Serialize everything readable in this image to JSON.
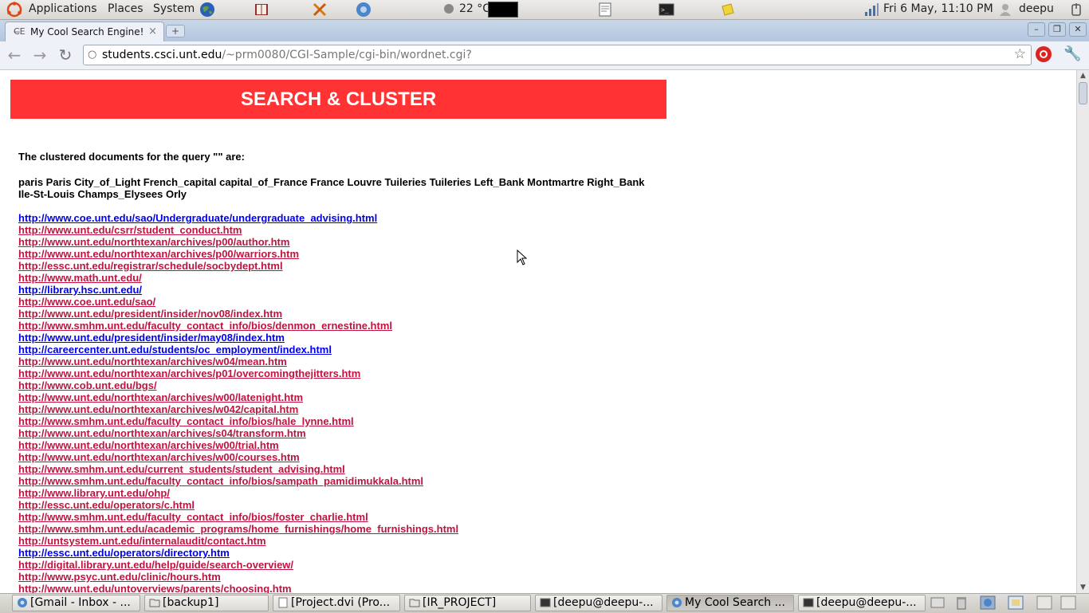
{
  "top_panel": {
    "applications_label": "Applications",
    "places_label": "Places",
    "system_label": "System",
    "temperature": "22 °C",
    "datetime": "Fri  6 May, 11:10 PM",
    "user": "deepu"
  },
  "browser": {
    "tab_title": "My Cool Search Engine!",
    "tab_close": "×",
    "new_tab": "+",
    "url_host": "students.csci.unt.edu",
    "url_path": "/~prm0080/CGI-Sample/cgi-bin/wordnet.cgi?"
  },
  "page": {
    "banner_title": "SEARCH & CLUSTER",
    "heading": "The clustered documents for the query \"\" are:",
    "synonyms": "paris Paris City_of_Light French_capital capital_of_France France Louvre Tuileries Tuileries Left_Bank Montmartre Right_Bank Ile-St-Louis Champs_Elysees Orly",
    "links": [
      {
        "text": "http://www.coe.unt.edu/sao/Undergraduate/undergraduate_advising.html",
        "visited": false
      },
      {
        "text": "http://www.unt.edu/csrr/student_conduct.htm",
        "visited": true
      },
      {
        "text": "http://www.unt.edu/northtexan/archives/p00/author.htm",
        "visited": true
      },
      {
        "text": "http://www.unt.edu/northtexan/archives/p00/warriors.htm",
        "visited": true
      },
      {
        "text": "http://essc.unt.edu/registrar/schedule/socbydept.html",
        "visited": true
      },
      {
        "text": "http://www.math.unt.edu/",
        "visited": true
      },
      {
        "text": "http://library.hsc.unt.edu/",
        "visited": false
      },
      {
        "text": "http://www.coe.unt.edu/sao/",
        "visited": true
      },
      {
        "text": "http://www.unt.edu/president/insider/nov08/index.htm",
        "visited": true
      },
      {
        "text": "http://www.smhm.unt.edu/faculty_contact_info/bios/denmon_ernestine.html",
        "visited": true
      },
      {
        "text": "http://www.unt.edu/president/insider/may08/index.htm",
        "visited": false
      },
      {
        "text": "http://careercenter.unt.edu/students/oc_employment/index.html",
        "visited": false
      },
      {
        "text": "http://www.unt.edu/northtexan/archives/w04/mean.htm",
        "visited": true
      },
      {
        "text": "http://www.unt.edu/northtexan/archives/p01/overcomingthejitters.htm",
        "visited": true
      },
      {
        "text": "http://www.cob.unt.edu/bgs/",
        "visited": true
      },
      {
        "text": "http://www.unt.edu/northtexan/archives/w00/latenight.htm",
        "visited": true
      },
      {
        "text": "http://www.unt.edu/northtexan/archives/w042/capital.htm",
        "visited": true
      },
      {
        "text": "http://www.smhm.unt.edu/faculty_contact_info/bios/hale_lynne.html",
        "visited": true
      },
      {
        "text": "http://www.unt.edu/northtexan/archives/s04/transform.htm",
        "visited": true
      },
      {
        "text": "http://www.unt.edu/northtexan/archives/w00/trial.htm",
        "visited": true
      },
      {
        "text": "http://www.unt.edu/northtexan/archives/w00/courses.htm",
        "visited": true
      },
      {
        "text": "http://www.smhm.unt.edu/current_students/student_advising.html",
        "visited": true
      },
      {
        "text": "http://www.smhm.unt.edu/faculty_contact_info/bios/sampath_pamidimukkala.html",
        "visited": true
      },
      {
        "text": "http://www.library.unt.edu/ohp/",
        "visited": true
      },
      {
        "text": "http://essc.unt.edu/operators/c.html",
        "visited": true
      },
      {
        "text": "http://www.smhm.unt.edu/faculty_contact_info/bios/foster_charlie.html",
        "visited": true
      },
      {
        "text": "http://www.smhm.unt.edu/academic_programs/home_furnishings/home_furnishings.html",
        "visited": true
      },
      {
        "text": "http://untsystem.unt.edu/internalaudit/contact.htm",
        "visited": true
      },
      {
        "text": "http://essc.unt.edu/operators/directory.htm",
        "visited": false
      },
      {
        "text": "http://digital.library.unt.edu/help/guide/search-overview/",
        "visited": true
      },
      {
        "text": "http://www.psyc.unt.edu/clinic/hours.htm",
        "visited": true
      },
      {
        "text": "http://www.unt.edu/untoverviews/parents/choosing.htm",
        "visited": true
      }
    ]
  },
  "taskbar": {
    "tasks": [
      {
        "label": "[Gmail - Inbox - ...",
        "icon": "chrome-icon",
        "active": false
      },
      {
        "label": "[backup1]",
        "icon": "folder-icon",
        "active": false
      },
      {
        "label": "[Project.dvi (Pro...",
        "icon": "document-icon",
        "active": false
      },
      {
        "label": "[IR_PROJECT]",
        "icon": "folder-icon",
        "active": false
      },
      {
        "label": "[deepu@deepu-...",
        "icon": "terminal-icon",
        "active": false
      },
      {
        "label": "My Cool Search ...",
        "icon": "chrome-icon",
        "active": true
      },
      {
        "label": "[deepu@deepu-...",
        "icon": "terminal-icon",
        "active": false
      }
    ]
  },
  "colors": {
    "banner": "#ff3333",
    "link_unvisited": "#0000ee",
    "link_visited": "#c0133f"
  }
}
